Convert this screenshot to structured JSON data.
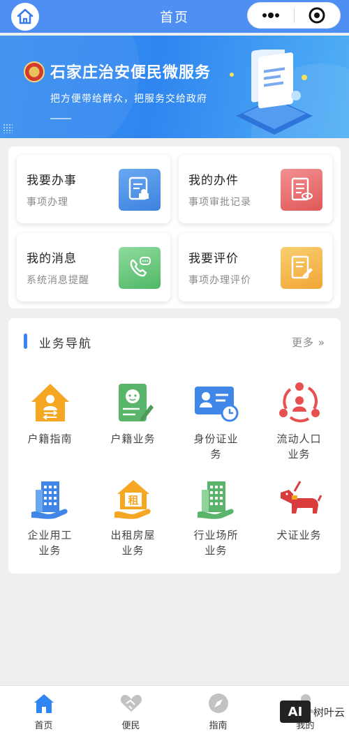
{
  "header": {
    "title": "首页",
    "capsule_more": "•••"
  },
  "banner": {
    "title": "石家庄治安便民微服务",
    "subtitle": "把方便带给群众，把服务交给政府"
  },
  "service_cards": [
    {
      "title": "我要办事",
      "subtitle": "事项办理",
      "icon": "certificate-icon",
      "color": "#4a90e2"
    },
    {
      "title": "我的办件",
      "subtitle": "事项审批记录",
      "icon": "document-record-icon",
      "color": "#e86b6b"
    },
    {
      "title": "我的消息",
      "subtitle": "系统消息提醒",
      "icon": "phone-message-icon",
      "color": "#5fc37a"
    },
    {
      "title": "我要评价",
      "subtitle": "事项办理评价",
      "icon": "review-icon",
      "color": "#f5b040"
    }
  ],
  "business_nav": {
    "title": "业务导航",
    "more": "更多 »",
    "items": [
      {
        "label": "户籍指南",
        "icon": "household-guide-icon",
        "color": "#f5a623"
      },
      {
        "label": "户籍业务",
        "icon": "household-business-icon",
        "color": "#5ab46a"
      },
      {
        "label": "身份证业务",
        "icon": "id-card-icon",
        "color": "#3f86e8"
      },
      {
        "label": "流动人口业务",
        "icon": "floating-population-icon",
        "color": "#e85050"
      },
      {
        "label": "企业用工业务",
        "icon": "enterprise-employment-icon",
        "color": "#3f86e8"
      },
      {
        "label": "出租房屋业务",
        "icon": "rental-housing-icon",
        "color": "#f5a623"
      },
      {
        "label": "行业场所业务",
        "icon": "industry-venue-icon",
        "color": "#5ab46a"
      },
      {
        "label": "犬证业务",
        "icon": "dog-license-icon",
        "color": "#d93c3c"
      }
    ]
  },
  "tabbar": {
    "items": [
      {
        "label": "首页",
        "icon": "home-icon",
        "active": true
      },
      {
        "label": "便民",
        "icon": "handshake-icon",
        "active": false
      },
      {
        "label": "指南",
        "icon": "compass-icon",
        "active": false
      },
      {
        "label": "我的",
        "icon": "user-icon",
        "active": false
      }
    ]
  },
  "watermark": {
    "badge": "AI",
    "text": "树叶云"
  },
  "colors": {
    "primary": "#4f8ff4",
    "banner": "#2f86f0",
    "accent_bar": "#3b82f6"
  }
}
